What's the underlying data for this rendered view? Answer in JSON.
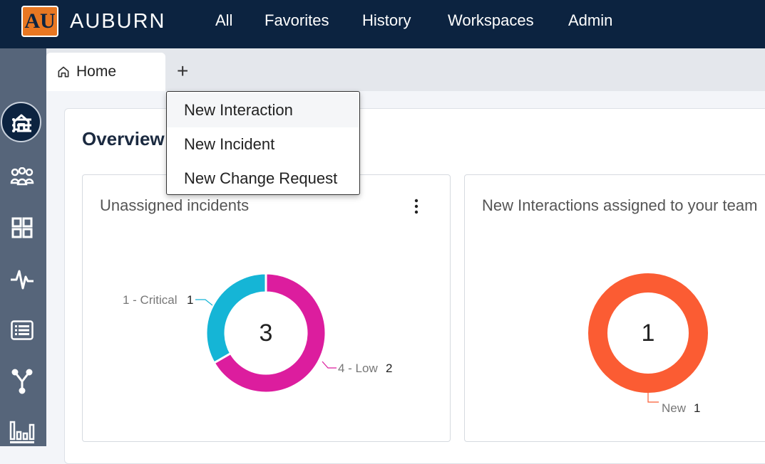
{
  "header": {
    "brand": "AUBURN",
    "logo_text": "AU",
    "nav": [
      "All",
      "Favorites",
      "History",
      "Workspaces",
      "Admin"
    ]
  },
  "sidebar": {
    "icons": [
      "home-icon",
      "list-icon",
      "groups-icon",
      "dashboard-icon",
      "activity-icon",
      "report-icon",
      "workflow-icon",
      "analytics-icon"
    ]
  },
  "tabs": {
    "items": [
      {
        "label": "Home",
        "icon": "home-icon"
      }
    ],
    "add_label": "+"
  },
  "menu": {
    "items": [
      "New Interaction",
      "New Incident",
      "New Change Request"
    ]
  },
  "main": {
    "title": "Overview"
  },
  "widgets": [
    {
      "title": "Unassigned incidents",
      "total": "3",
      "type": "donut",
      "segments": [
        {
          "label": "4 - Low",
          "value": 2,
          "color": "#dc1d9e"
        },
        {
          "label": "1 - Critical",
          "value": 1,
          "color": "#15b5d6"
        }
      ]
    },
    {
      "title": "New Interactions assigned to your team",
      "total": "1",
      "type": "donut",
      "segments": [
        {
          "label": "New",
          "value": 1,
          "color": "#fb5c33"
        }
      ]
    }
  ],
  "colors": {
    "topbar": "#0c2340",
    "sidebar": "#56657a",
    "logo": "#e87722"
  }
}
